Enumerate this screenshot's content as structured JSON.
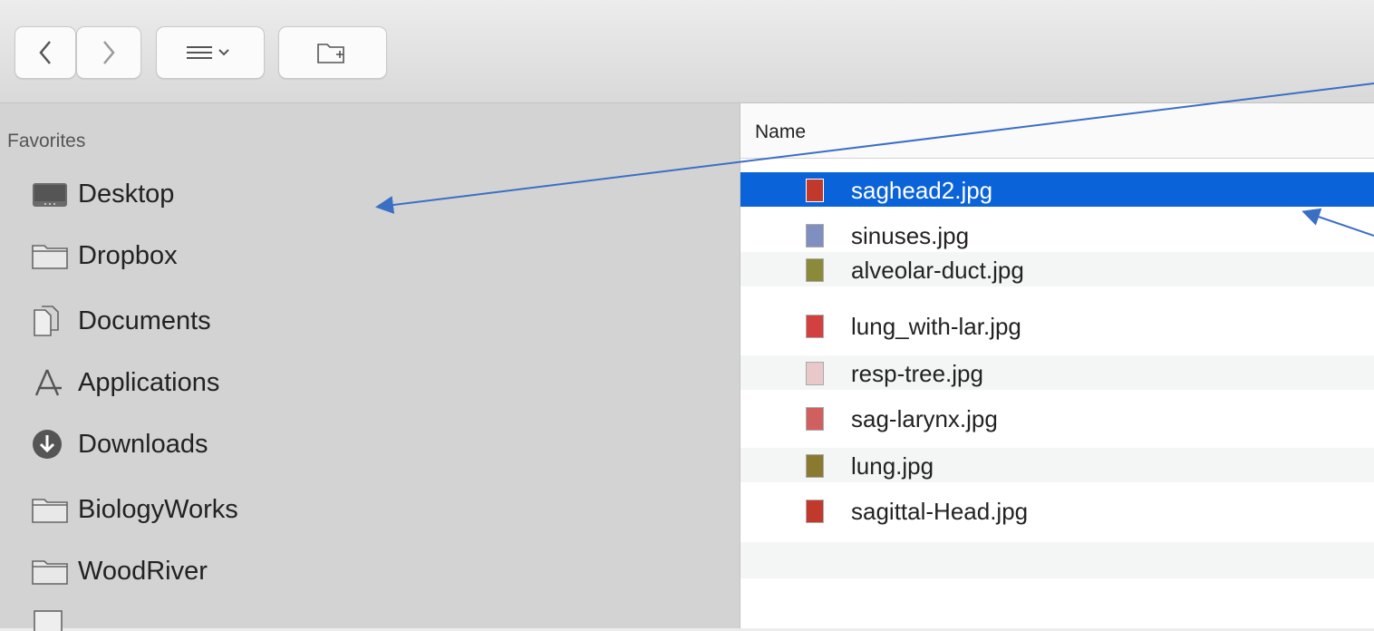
{
  "toolbar": {
    "back_icon": "chevron-left-icon",
    "forward_icon": "chevron-right-icon",
    "view_icon": "list-view-icon",
    "new_folder_icon": "new-folder-icon"
  },
  "sidebar": {
    "header": "Favorites",
    "items": [
      {
        "label": "Desktop",
        "icon": "desktop-icon"
      },
      {
        "label": "Dropbox",
        "icon": "folder-icon"
      },
      {
        "label": "Documents",
        "icon": "documents-icon"
      },
      {
        "label": "Applications",
        "icon": "applications-icon"
      },
      {
        "label": "Downloads",
        "icon": "downloads-icon"
      },
      {
        "label": "BiologyWorks",
        "icon": "folder-icon"
      },
      {
        "label": "WoodRiver",
        "icon": "folder-icon"
      }
    ]
  },
  "file_list": {
    "column_header": "Name",
    "selected_index": 0,
    "files": [
      {
        "name": "saghead2.jpg",
        "thumb_color": "#c0392b"
      },
      {
        "name": "sinuses.jpg",
        "thumb_color": "#7f8fc0"
      },
      {
        "name": "alveolar-duct.jpg",
        "thumb_color": "#8a8a3a"
      },
      {
        "name": "lung_with-lar.jpg",
        "thumb_color": "#d24040"
      },
      {
        "name": "resp-tree.jpg",
        "thumb_color": "#e8c8c8"
      },
      {
        "name": "sag-larynx.jpg",
        "thumb_color": "#d06060"
      },
      {
        "name": "lung.jpg",
        "thumb_color": "#8a7a30"
      },
      {
        "name": "sagittal-Head.jpg",
        "thumb_color": "#c0392b"
      }
    ]
  },
  "colors": {
    "selection": "#0a63d8",
    "annotation_arrow": "#3b6fc4"
  }
}
